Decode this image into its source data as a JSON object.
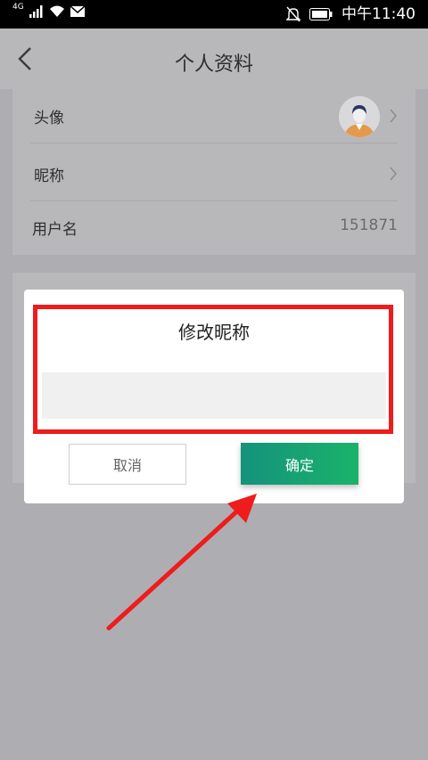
{
  "status_bar": {
    "network": "4G",
    "time": "中午11:40"
  },
  "nav": {
    "title": "个人资料"
  },
  "profile": {
    "avatar_label": "头像",
    "nickname_label": "昵称",
    "username_label": "用户名",
    "username_value": "151871"
  },
  "dialog": {
    "title": "修改昵称",
    "input_value": "",
    "cancel_label": "取消",
    "confirm_label": "确定"
  },
  "colors": {
    "accent_start": "#14927c",
    "accent_end": "#1ab36a",
    "annotation": "#ee1c1c"
  }
}
